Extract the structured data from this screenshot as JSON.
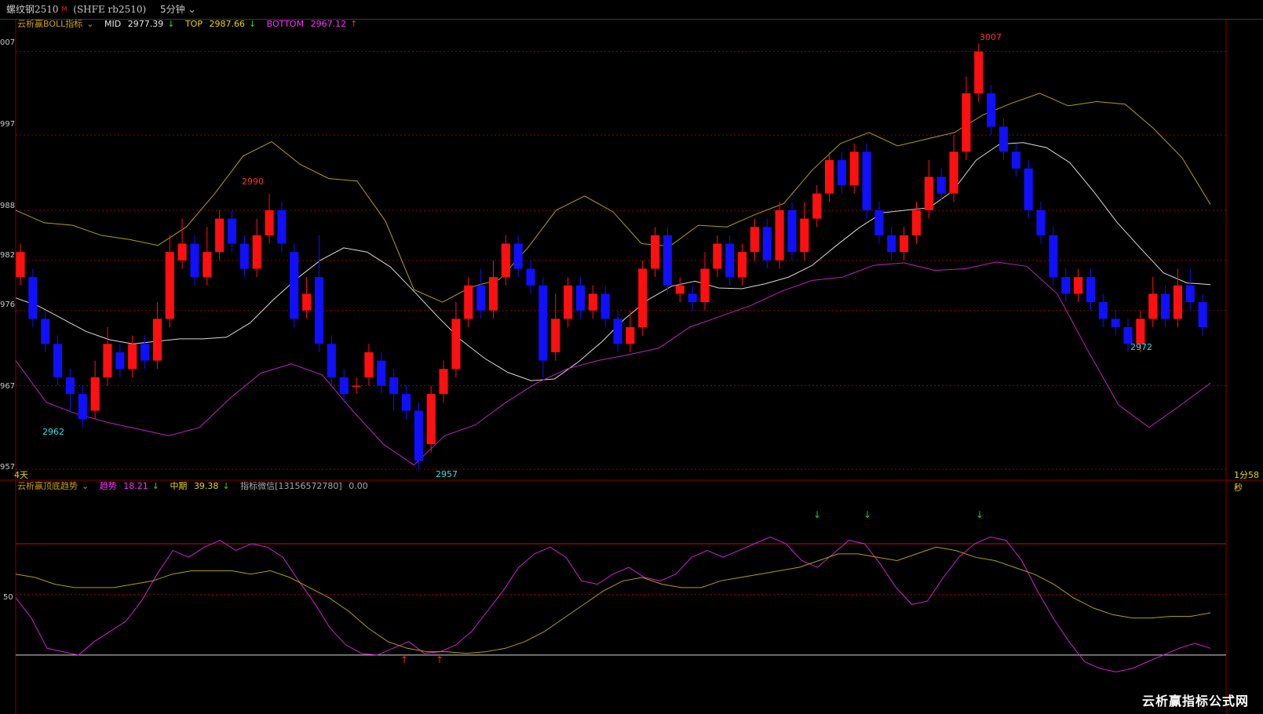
{
  "header": {
    "symbol": "螺纹钢2510",
    "symbol_sup": "M",
    "code": "(SHFE rb2510)",
    "period": "5分钟"
  },
  "main_panel": {
    "indicator_name": "云析赢BOLL指标",
    "mid_label": "MID",
    "mid_value": "2977.39",
    "top_label": "TOP",
    "top_value": "2987.66",
    "bottom_label": "BOTTOM",
    "bottom_value": "2967.12",
    "y_labels": [
      "007",
      "997",
      "988",
      "982",
      "976",
      "967",
      "957"
    ],
    "annotations": [
      {
        "text": "3007",
        "color": "#ff3030"
      },
      {
        "text": "2990",
        "color": "#ff3030"
      },
      {
        "text": "2962",
        "color": "#30e0e0"
      },
      {
        "text": "2957",
        "color": "#30e0e0"
      },
      {
        "text": "2972",
        "color": "#30e0e0"
      }
    ],
    "left_corner": "4天",
    "right_corner": "1分58秒"
  },
  "sub_panel": {
    "indicator_name": "云析赢顶底趋势",
    "trend_label": "趋势",
    "trend_value": "18.21",
    "mid_label": "中期",
    "mid_value": "39.38",
    "wechat_label": "指标微信[13156572780]",
    "wechat_value": "0.00",
    "y_label": "50"
  },
  "watermark": "云析赢指标公式网",
  "colors": {
    "up": "#ff1010",
    "down": "#1010ff",
    "mid_line": "#d8d8d8",
    "top_line": "#b0a000",
    "bottom_line": "#c020c0",
    "grid": "#8b0000"
  },
  "chart_data": [
    {
      "type": "candlestick",
      "title": "云析赢BOLL指标",
      "y_ticks": [
        3007,
        2997,
        2988,
        2982,
        2976,
        2967,
        2957
      ],
      "ylim": [
        2957,
        3010
      ],
      "series": [
        {
          "name": "MID",
          "values": [
            2977.5,
            2976.5,
            2975.0,
            2973.5,
            2972.5,
            2972.0,
            2972.3,
            2972.6,
            2972.6,
            2972.8,
            2974.5,
            2977.3,
            2979.8,
            2982.0,
            2983.5,
            2983.0,
            2981.2,
            2978.3,
            2975.3,
            2972.5,
            2970.3,
            2968.6,
            2967.6,
            2967.8,
            2969.8,
            2972.2,
            2975.0,
            2977.3,
            2978.9,
            2979.5,
            2978.7,
            2978.6,
            2979.2,
            2980.0,
            2981.4,
            2983.7,
            2985.9,
            2987.7,
            2988.0,
            2988.3,
            2990.3,
            2994.0,
            2995.9,
            2996.1,
            2995.5,
            2993.7,
            2990.3,
            2986.6,
            2983.5,
            2980.5,
            2979.3,
            2979.1
          ]
        },
        {
          "name": "TOP",
          "values": [
            2988.0,
            2986.5,
            2986.2,
            2985.0,
            2984.5,
            2983.8,
            2986.0,
            2990.0,
            2994.5,
            2996.2,
            2993.5,
            2991.8,
            2991.5,
            2986.7,
            2978.5,
            2977.0,
            2978.8,
            2979.7,
            2983.5,
            2988.0,
            2989.7,
            2987.8,
            2984.0,
            2983.7,
            2986.2,
            2986.0,
            2987.5,
            2988.8,
            2992.8,
            2996.0,
            2997.3,
            2995.7,
            2996.5,
            2997.3,
            2999.4,
            3000.8,
            3002.0,
            3000.5,
            3001.0,
            3000.7,
            2997.8,
            2994.3,
            2988.7
          ]
        },
        {
          "name": "BOTTOM",
          "values": [
            2970.0,
            2965.0,
            2963.6,
            2962.6,
            2961.8,
            2961.0,
            2962.0,
            2965.5,
            2968.5,
            2969.6,
            2968.3,
            2964.0,
            2960.0,
            2957.5,
            2961.0,
            2962.3,
            2965.0,
            2967.3,
            2969.0,
            2970.0,
            2970.7,
            2971.5,
            2974.0,
            2975.3,
            2976.6,
            2978.3,
            2979.6,
            2980.0,
            2981.4,
            2981.7,
            2980.8,
            2981.0,
            2981.8,
            2981.3,
            2978.0,
            2971.2,
            2964.7,
            2962.0,
            2964.6,
            2967.3
          ]
        }
      ],
      "candles": [
        [
          2983,
          2980,
          2984,
          2979,
          "up"
        ],
        [
          2980,
          2975,
          2981,
          2974,
          "down"
        ],
        [
          2975,
          2972,
          2976,
          2971,
          "down"
        ],
        [
          2972,
          2968,
          2973,
          2967,
          "down"
        ],
        [
          2968,
          2966,
          2969,
          2964,
          "down"
        ],
        [
          2966,
          2963,
          2967,
          2962,
          "down"
        ],
        [
          2964,
          2968,
          2970,
          2963,
          "up"
        ],
        [
          2968,
          2972,
          2974,
          2967,
          "up"
        ],
        [
          2971,
          2969,
          2972,
          2968,
          "down"
        ],
        [
          2969,
          2972,
          2973,
          2968,
          "up"
        ],
        [
          2972,
          2970,
          2973,
          2969,
          "down"
        ],
        [
          2970,
          2975,
          2977,
          2969,
          "up"
        ],
        [
          2975,
          2983,
          2985,
          2974,
          "up"
        ],
        [
          2982,
          2984,
          2987,
          2981,
          "up"
        ],
        [
          2984,
          2980,
          2985,
          2979,
          "down"
        ],
        [
          2980,
          2983,
          2986,
          2979,
          "up"
        ],
        [
          2983,
          2987,
          2988,
          2982,
          "up"
        ],
        [
          2987,
          2984,
          2988,
          2983,
          "down"
        ],
        [
          2984,
          2981,
          2985,
          2980,
          "down"
        ],
        [
          2981,
          2985,
          2987,
          2980,
          "up"
        ],
        [
          2985,
          2988,
          2990,
          2984,
          "up"
        ],
        [
          2988,
          2984,
          2989,
          2983,
          "down"
        ],
        [
          2983,
          2975,
          2984,
          2974,
          "down"
        ],
        [
          2976,
          2978,
          2980,
          2975,
          "up"
        ],
        [
          2980,
          2972,
          2985,
          2971,
          "down"
        ],
        [
          2972,
          2968,
          2973,
          2967,
          "down"
        ],
        [
          2968,
          2966,
          2969,
          2965,
          "down"
        ],
        [
          2967,
          2967,
          2968,
          2966,
          "up"
        ],
        [
          2968,
          2971,
          2972,
          2967,
          "up"
        ],
        [
          2970,
          2967,
          2971,
          2966,
          "down"
        ],
        [
          2968,
          2966,
          2969,
          2964,
          "down"
        ],
        [
          2966,
          2964,
          2967,
          2963,
          "down"
        ],
        [
          2964,
          2958,
          2965,
          2957,
          "down"
        ],
        [
          2960,
          2966,
          2967,
          2959,
          "up"
        ],
        [
          2966,
          2969,
          2970,
          2965,
          "up"
        ],
        [
          2969,
          2975,
          2977,
          2968,
          "up"
        ],
        [
          2975,
          2979,
          2980,
          2974,
          "up"
        ],
        [
          2979,
          2976,
          2981,
          2975,
          "down"
        ],
        [
          2976,
          2980,
          2982,
          2975,
          "up"
        ],
        [
          2980,
          2984,
          2985,
          2979,
          "up"
        ],
        [
          2984,
          2981,
          2985,
          2980,
          "down"
        ],
        [
          2981,
          2979,
          2982,
          2978,
          "down"
        ],
        [
          2979,
          2970,
          2980,
          2968,
          "down"
        ],
        [
          2971,
          2975,
          2978,
          2970,
          "up"
        ],
        [
          2975,
          2979,
          2980,
          2974,
          "up"
        ],
        [
          2979,
          2976,
          2980,
          2975,
          "down"
        ],
        [
          2976,
          2978,
          2979,
          2975,
          "up"
        ],
        [
          2978,
          2975,
          2979,
          2974,
          "down"
        ],
        [
          2975,
          2972,
          2976,
          2971,
          "down"
        ],
        [
          2972,
          2974,
          2976,
          2971,
          "up"
        ],
        [
          2974,
          2981,
          2982,
          2973,
          "up"
        ],
        [
          2981,
          2985,
          2986,
          2980,
          "up"
        ],
        [
          2985,
          2979,
          2986,
          2978,
          "down"
        ],
        [
          2979,
          2978,
          2980,
          2977,
          "up"
        ],
        [
          2978,
          2977,
          2979,
          2976,
          "down"
        ],
        [
          2977,
          2981,
          2983,
          2976,
          "up"
        ],
        [
          2981,
          2984,
          2985,
          2980,
          "up"
        ],
        [
          2984,
          2980,
          2985,
          2979,
          "down"
        ],
        [
          2980,
          2983,
          2984,
          2979,
          "up"
        ],
        [
          2983,
          2986,
          2987,
          2982,
          "up"
        ],
        [
          2986,
          2982,
          2987,
          2981,
          "down"
        ],
        [
          2982,
          2988,
          2989,
          2981,
          "up"
        ],
        [
          2988,
          2983,
          2989,
          2982,
          "down"
        ],
        [
          2983,
          2987,
          2989,
          2982,
          "up"
        ],
        [
          2987,
          2990,
          2991,
          2986,
          "up"
        ],
        [
          2990,
          2994,
          2995,
          2989,
          "up"
        ],
        [
          2994,
          2991,
          2995,
          2990,
          "down"
        ],
        [
          2991,
          2995,
          2996,
          2990,
          "up"
        ],
        [
          2995,
          2988,
          2996,
          2987,
          "down"
        ],
        [
          2988,
          2985,
          2989,
          2984,
          "down"
        ],
        [
          2985,
          2983,
          2986,
          2982,
          "down"
        ],
        [
          2983,
          2985,
          2986,
          2982,
          "up"
        ],
        [
          2985,
          2988,
          2989,
          2984,
          "up"
        ],
        [
          2988,
          2992,
          2994,
          2987,
          "up"
        ],
        [
          2992,
          2990,
          2993,
          2989,
          "down"
        ],
        [
          2990,
          2995,
          2997,
          2989,
          "up"
        ],
        [
          2995,
          3002,
          3004,
          2994,
          "up"
        ],
        [
          3002,
          3007,
          3008,
          3001,
          "up"
        ],
        [
          3002,
          2998,
          3003,
          2997,
          "down"
        ],
        [
          2998,
          2995,
          2999,
          2994,
          "down"
        ],
        [
          2995,
          2993,
          2996,
          2992,
          "down"
        ],
        [
          2993,
          2988,
          2994,
          2987,
          "down"
        ],
        [
          2988,
          2985,
          2989,
          2984,
          "down"
        ],
        [
          2985,
          2980,
          2986,
          2979,
          "down"
        ],
        [
          2980,
          2978,
          2981,
          2977,
          "down"
        ],
        [
          2978,
          2980,
          2981,
          2977,
          "up"
        ],
        [
          2980,
          2977,
          2981,
          2976,
          "down"
        ],
        [
          2977,
          2975,
          2978,
          2974,
          "down"
        ],
        [
          2975,
          2974,
          2976,
          2973,
          "down"
        ],
        [
          2974,
          2972,
          2975,
          2971,
          "down"
        ],
        [
          2972,
          2975,
          2976,
          2971,
          "up"
        ],
        [
          2975,
          2978,
          2980,
          2974,
          "up"
        ],
        [
          2978,
          2975,
          2979,
          2974,
          "down"
        ],
        [
          2975,
          2979,
          2981,
          2974,
          "up"
        ],
        [
          2979,
          2977,
          2981,
          2976,
          "down"
        ],
        [
          2977,
          2974,
          2978,
          2973,
          "down"
        ]
      ]
    },
    {
      "type": "line",
      "title": "云析赢顶底趋势",
      "y_ticks": [
        50
      ],
      "series": [
        {
          "name": "趋势",
          "values": [
            48,
            36,
            18,
            16,
            14,
            22,
            28,
            34,
            46,
            62,
            76,
            72,
            78,
            82,
            76,
            80,
            78,
            72,
            58,
            45,
            30,
            20,
            15,
            14,
            18,
            22,
            15,
            16,
            20,
            28,
            40,
            52,
            66,
            74,
            78,
            72,
            58,
            56,
            62,
            66,
            60,
            58,
            62,
            72,
            76,
            72,
            76,
            80,
            84,
            80,
            70,
            66,
            74,
            82,
            80,
            68,
            54,
            44,
            46,
            60,
            72,
            80,
            84,
            82,
            70,
            52,
            36,
            22,
            10,
            6,
            4,
            6,
            10,
            14,
            18,
            21,
            18
          ]
        },
        {
          "name": "中期",
          "values": [
            62,
            60,
            56,
            54,
            54,
            54,
            56,
            58,
            62,
            64,
            64,
            64,
            62,
            64,
            60,
            54,
            48,
            40,
            30,
            22,
            18,
            16,
            16,
            15,
            16,
            18,
            22,
            28,
            36,
            44,
            52,
            58,
            60,
            56,
            54,
            54,
            58,
            60,
            62,
            64,
            66,
            70,
            74,
            74,
            72,
            70,
            74,
            78,
            76,
            72,
            70,
            66,
            62,
            56,
            48,
            42,
            38,
            36,
            36,
            37,
            37,
            39
          ]
        }
      ]
    }
  ]
}
